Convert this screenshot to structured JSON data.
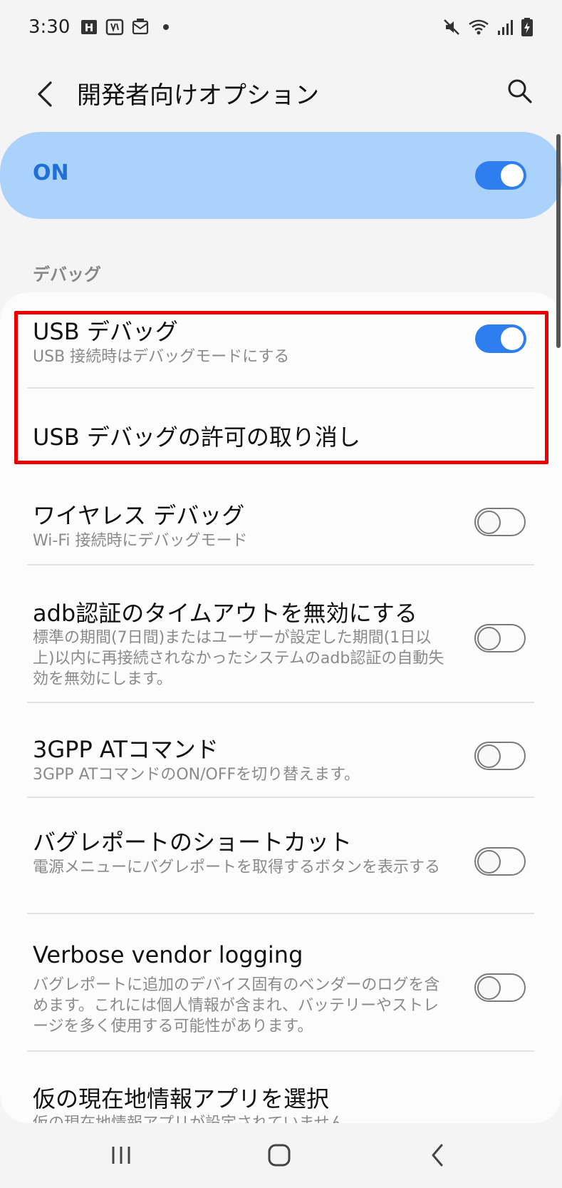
{
  "status_bar": {
    "time": "3:30",
    "left_icons": [
      "h-icon",
      "voicemail-icon",
      "sim-card-icon",
      "dot-icon"
    ],
    "right_icons": [
      "mute-icon",
      "wifi-icon",
      "signal-icon",
      "battery-charging-icon"
    ]
  },
  "header": {
    "title": "開発者向けオプション"
  },
  "master_switch": {
    "label": "ON",
    "state": "on"
  },
  "section": {
    "label": "デバッグ"
  },
  "items": [
    {
      "title": "USB デバッグ",
      "subtitle": "USB 接続時はデバッグモードにする",
      "toggle": "on"
    },
    {
      "title": "USB デバッグの許可の取り消し"
    },
    {
      "title": "ワイヤレス デバッグ",
      "subtitle": "Wi-Fi 接続時にデバッグモード",
      "toggle": "off"
    },
    {
      "title": "adb認証のタイムアウトを無効にする",
      "subtitle": "標準の期間(7日間)またはユーザーが設定した期間(1日以上)以内に再接続されなかったシステムのadb認証の自動失効を無効にします。",
      "toggle": "off"
    },
    {
      "title": "3GPP ATコマンド",
      "subtitle": "3GPP ATコマンドのON/OFFを切り替えます。",
      "toggle": "off"
    },
    {
      "title": "バグレポートのショートカット",
      "subtitle": "電源メニューにバグレポートを取得するボタンを表示する",
      "toggle": "off"
    },
    {
      "title": "Verbose vendor logging",
      "subtitle": "バグレポートに追加のデバイス固有のベンダーのログを含めます。これには個人情報が含まれ、バッテリーやストレージを多く使用する可能性があります。",
      "toggle": "off"
    },
    {
      "title": "仮の現在地情報アプリを選択",
      "subtitle": "仮の現在地情報アプリが設定されていません"
    }
  ],
  "colors": {
    "accent": "#2f7ef0",
    "master_bg": "#abd2fa",
    "highlight": "#ee0000"
  },
  "nav_bar": {
    "buttons": [
      "recents-icon",
      "home-icon",
      "back-icon"
    ]
  }
}
